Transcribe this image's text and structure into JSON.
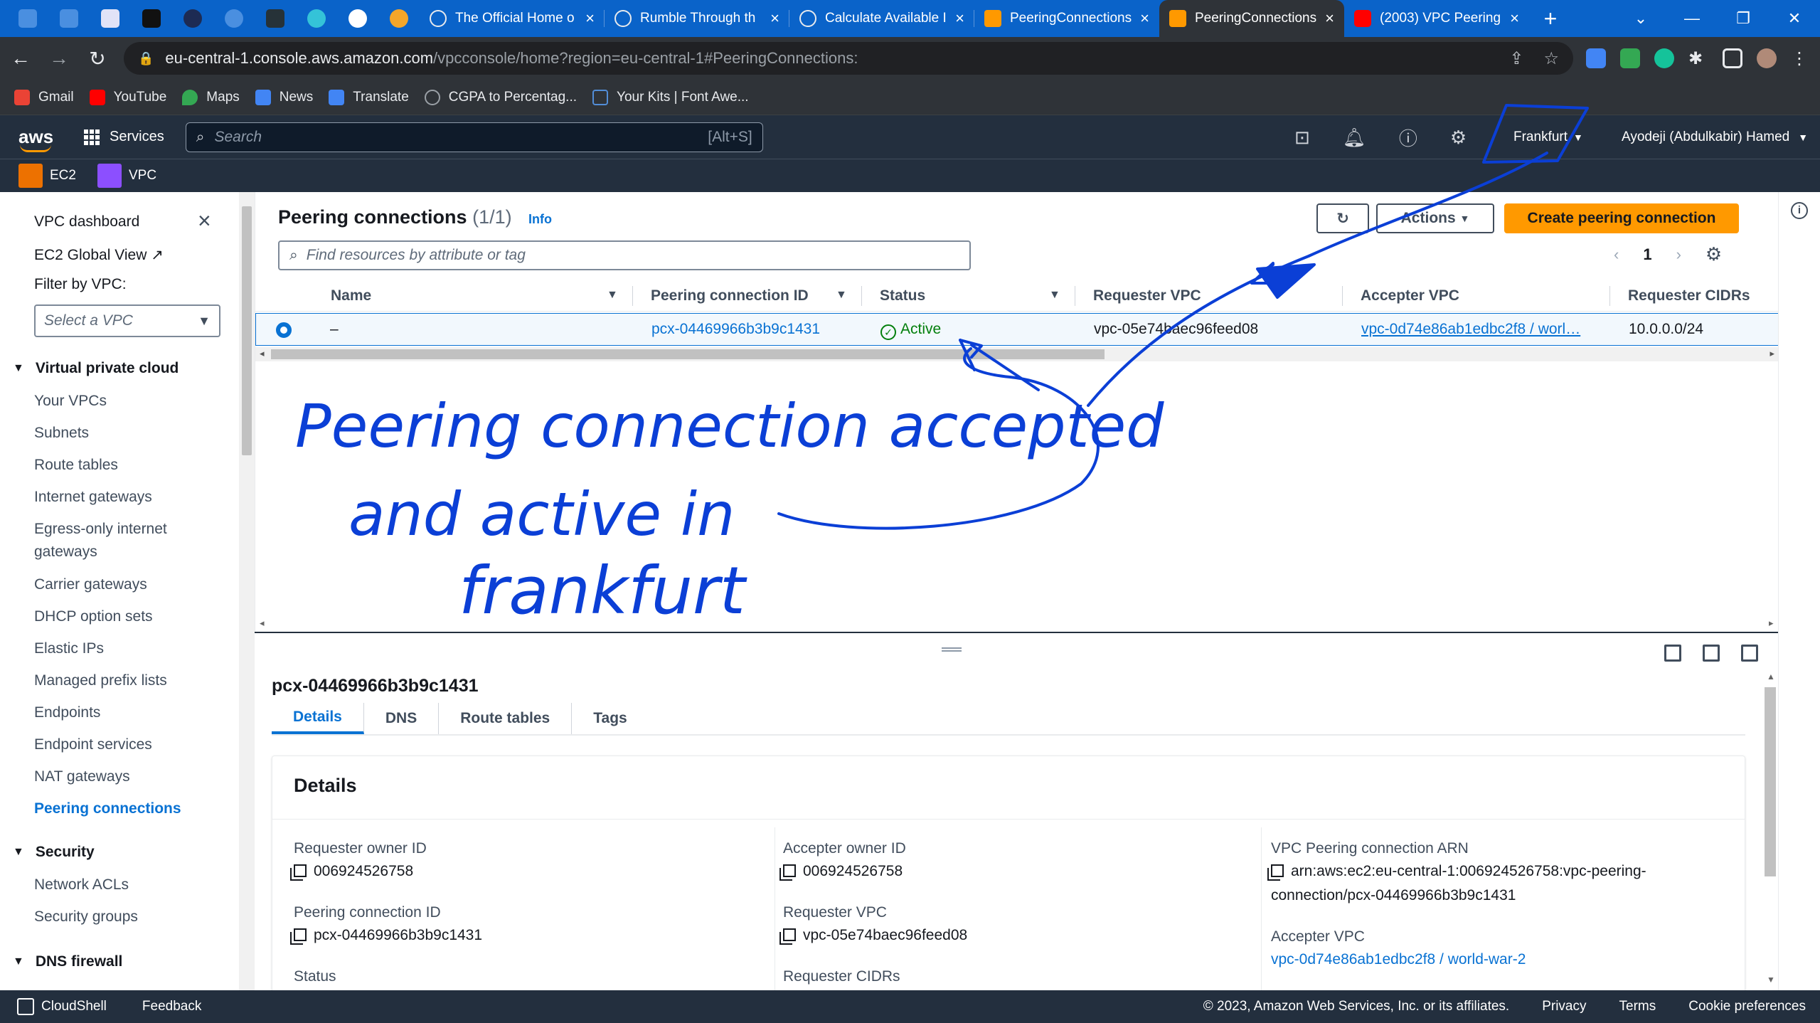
{
  "browser": {
    "tabs": [
      {
        "title": "The Official Home o",
        "favicon_color": "#e8eaed"
      },
      {
        "title": "Rumble Through th",
        "favicon_color": "#e8eaed"
      },
      {
        "title": "Calculate Available I",
        "favicon_color": "#e8eaed"
      },
      {
        "title": "PeeringConnections",
        "favicon_color": "#ff9900"
      },
      {
        "title": "PeeringConnections",
        "favicon_color": "#ff9900",
        "active": true
      },
      {
        "title": "(2003) VPC Peering",
        "favicon_color": "#ff0000"
      }
    ],
    "url_host": "eu-central-1.console.aws.amazon.com",
    "url_path": "/vpcconsole/home?region=eu-central-1#PeeringConnections:",
    "bookmarks": [
      {
        "label": "Gmail",
        "color": "#ea4335"
      },
      {
        "label": "YouTube",
        "color": "#ff0000"
      },
      {
        "label": "Maps",
        "color": "#34a853"
      },
      {
        "label": "News",
        "color": "#4285f4"
      },
      {
        "label": "Translate",
        "color": "#4285f4"
      },
      {
        "label": "CGPA to Percentag...",
        "color": "#9aa0a6"
      },
      {
        "label": "Your Kits | Font Awe...",
        "color": "#528dd7"
      }
    ]
  },
  "aws": {
    "logo": "aws",
    "services_label": "Services",
    "search_placeholder": "Search",
    "search_shortcut": "[Alt+S]",
    "region": "Frankfurt",
    "user": "Ayodeji (Abdulkabir) Hamed",
    "favorites": [
      {
        "label": "EC2",
        "color": "#ed7100"
      },
      {
        "label": "VPC",
        "color": "#8c4fff"
      }
    ]
  },
  "sidenav": {
    "title": "VPC dashboard",
    "global_view": "EC2 Global View",
    "filter_label": "Filter by VPC:",
    "filter_placeholder": "Select a VPC",
    "section_vpc": "Virtual private cloud",
    "vpc_items": [
      "Your VPCs",
      "Subnets",
      "Route tables",
      "Internet gateways",
      "Egress-only internet",
      "gateways",
      "Carrier gateways",
      "DHCP option sets",
      "Elastic IPs",
      "Managed prefix lists",
      "Endpoints",
      "Endpoint services",
      "NAT gateways",
      "Peering connections"
    ],
    "section_security": "Security",
    "security_items": [
      "Network ACLs",
      "Security groups"
    ],
    "section_dns": "DNS firewall"
  },
  "main": {
    "title": "Peering connections",
    "count": "(1/1)",
    "info": "Info",
    "actions_label": "Actions",
    "create_label": "Create peering connection",
    "find_placeholder": "Find resources by attribute or tag",
    "page": "1",
    "columns": [
      "Name",
      "Peering connection ID",
      "Status",
      "Requester VPC",
      "Accepter VPC",
      "Requester CIDRs"
    ],
    "row": {
      "name": "–",
      "id": "pcx-04469966b3b9c1431",
      "status": "Active",
      "requester_vpc": "vpc-05e74baec96feed08",
      "accepter_vpc": "vpc-0d74e86ab1edbc2f8 / worl…",
      "requester_cidrs": "10.0.0.0/24"
    }
  },
  "details": {
    "id": "pcx-04469966b3b9c1431",
    "tabs": [
      "Details",
      "DNS",
      "Route tables",
      "Tags"
    ],
    "heading": "Details",
    "requester_owner_label": "Requester owner ID",
    "requester_owner": "006924526758",
    "peering_id_label": "Peering connection ID",
    "peering_id": "pcx-04469966b3b9c1431",
    "status_label": "Status",
    "accepter_owner_label": "Accepter owner ID",
    "accepter_owner": "006924526758",
    "requester_vpc_label": "Requester VPC",
    "requester_vpc": "vpc-05e74baec96feed08",
    "requester_cidrs_label": "Requester CIDRs",
    "arn_label": "VPC Peering connection ARN",
    "arn_line1": "arn:aws:ec2:eu-central-1:006924526758:vpc-peering-",
    "arn_line2": "connection/pcx-04469966b3b9c1431",
    "accepter_vpc_label": "Accepter VPC",
    "accepter_vpc": "vpc-0d74e86ab1edbc2f8 / world-war-2"
  },
  "annotation": {
    "line1": "Peering connection accepted",
    "line2": "and active in",
    "line3": "frankfurt",
    "color": "#0b3fd6"
  },
  "footer": {
    "cloudshell": "CloudShell",
    "feedback": "Feedback",
    "copyright": "© 2023, Amazon Web Services, Inc. or its affiliates.",
    "privacy": "Privacy",
    "terms": "Terms",
    "cookies": "Cookie preferences"
  }
}
